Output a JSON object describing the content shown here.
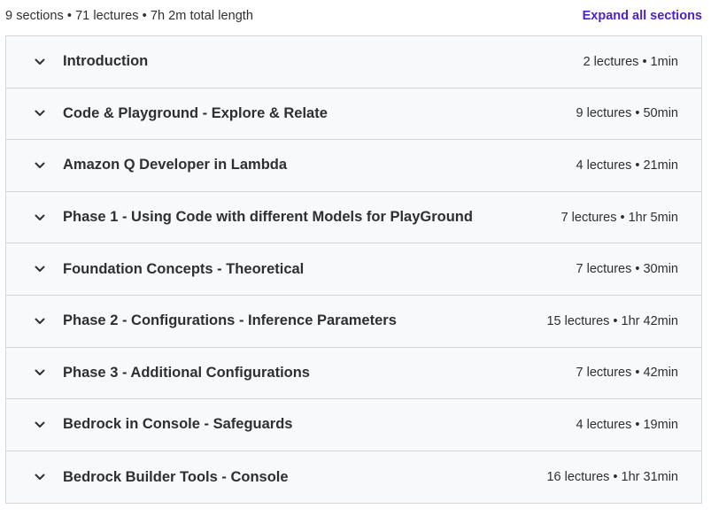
{
  "curriculum": {
    "summary": "9 sections • 71 lectures • 7h 2m total length",
    "expand_all_label": "Expand all sections",
    "sections": [
      {
        "title": "Introduction",
        "meta": "2 lectures • 1min"
      },
      {
        "title": "Code & Playground - Explore & Relate",
        "meta": "9 lectures • 50min"
      },
      {
        "title": "Amazon Q Developer in Lambda",
        "meta": "4 lectures • 21min"
      },
      {
        "title": "Phase 1 - Using Code with different Models for PlayGround",
        "meta": "7 lectures • 1hr 5min"
      },
      {
        "title": "Foundation Concepts - Theoretical",
        "meta": "7 lectures • 30min"
      },
      {
        "title": "Phase 2 - Configurations - Inference Parameters",
        "meta": "15 lectures • 1hr 42min"
      },
      {
        "title": "Phase 3 - Additional Configurations",
        "meta": "7 lectures • 42min"
      },
      {
        "title": "Bedrock in Console - Safeguards",
        "meta": "4 lectures • 19min"
      },
      {
        "title": "Bedrock Builder Tools - Console",
        "meta": "16 lectures • 1hr 31min"
      }
    ]
  },
  "icons": {
    "section_toggle": "chevron-down-icon"
  },
  "colors": {
    "accent": "#5022c3",
    "text": "#2d2f31",
    "row_background": "#f7f9fa",
    "border": "#d1d7dc"
  }
}
